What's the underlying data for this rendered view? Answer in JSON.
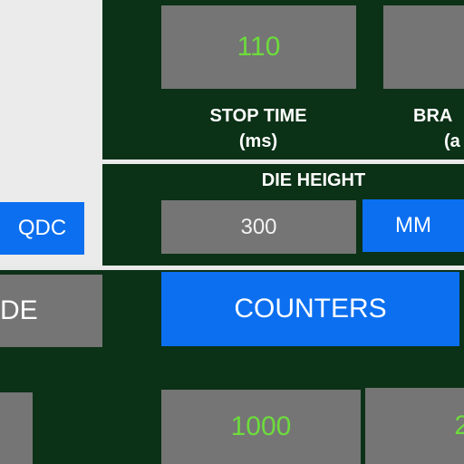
{
  "left_panel": {
    "qdc_button": "QDC",
    "mode_button_partial": "DE"
  },
  "stop_time": {
    "value": "110",
    "label": "STOP TIME",
    "unit": "(ms)"
  },
  "brake": {
    "label_partial": "BRA",
    "unit_partial": "(a"
  },
  "die_height": {
    "label": "DIE HEIGHT",
    "value": "300",
    "unit_button": "MM"
  },
  "counters_button": "COUNTERS",
  "counter_values": {
    "first": "1000",
    "second_partial": "2"
  },
  "colors": {
    "background": "#0b3116",
    "accent_blue": "#0b6ff0",
    "value_green": "#6ddc3c",
    "box_gray": "#757575"
  }
}
